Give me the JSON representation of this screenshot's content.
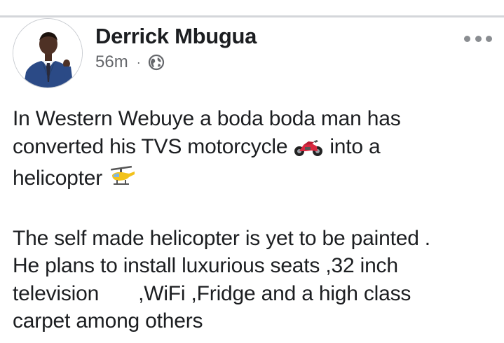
{
  "post": {
    "author": "Derrick Mbugua",
    "timestamp": "56m",
    "separator": "·",
    "privacy_icon": "globe-icon",
    "menu_icon": "more-horizontal-icon",
    "avatar_alt": "profile photo",
    "paragraph1": {
      "line1": "In Western Webuye a boda boda man has",
      "line2_before": "converted his TVS motorcycle",
      "line2_emoji": "motorcycle-emoji",
      "line2_after": "into a",
      "line3": "helicopter",
      "line3_emoji": "helicopter-emoji"
    },
    "paragraph2": {
      "line1": "The self made helicopter is yet to be painted .",
      "line2": "He plans to install luxurious seats ,32 inch",
      "line3_before": "television",
      "line3_after": ",WiFi ,Fridge and a high class",
      "line4": "carpet among others"
    }
  },
  "colors": {
    "text": "#1c1e21",
    "meta_text": "#65676b",
    "divider": "#d4d6da",
    "dots": "#8a8d91"
  }
}
